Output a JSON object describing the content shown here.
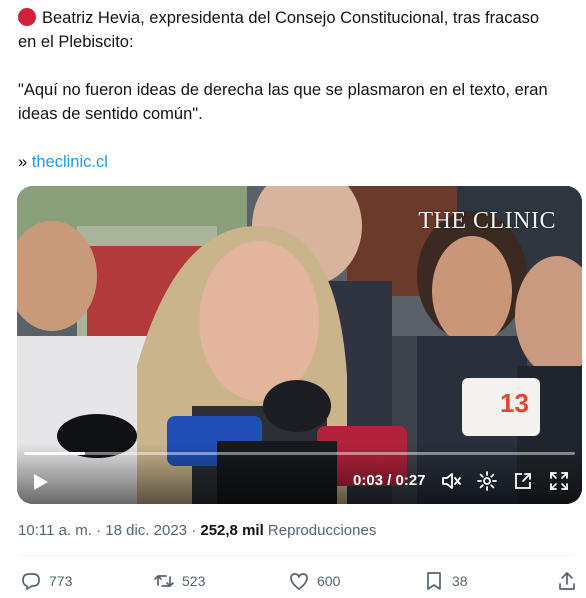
{
  "tweet": {
    "line1": "Beatriz Hevia, expresidenta del Consejo Constitucional, tras fracaso",
    "line2": "en el Plebiscito:",
    "quote_line1": "\"Aquí no fueron ideas de derecha las que se plasmaron en el texto, eran",
    "quote_line2": "ideas de sentido común\".",
    "link_prefix": "»",
    "link_text": "theclinic.cl"
  },
  "video": {
    "watermark": "THE CLINIC",
    "mic_channel": "13",
    "current_time": "0:03",
    "separator": "/",
    "duration": "0:27",
    "progress_fraction": 0.11
  },
  "meta": {
    "time": "10:11 a. m.",
    "dot": "·",
    "date": "18 dic. 2023",
    "views": "252,8 mil",
    "views_label": "Reproducciones"
  },
  "actions": {
    "replies": "773",
    "reposts": "523",
    "likes": "600",
    "bookmarks": "38"
  },
  "colors": {
    "accent_link": "#1d9bf0",
    "secondary_text": "#536471",
    "red_circle": "#d21f3c"
  }
}
